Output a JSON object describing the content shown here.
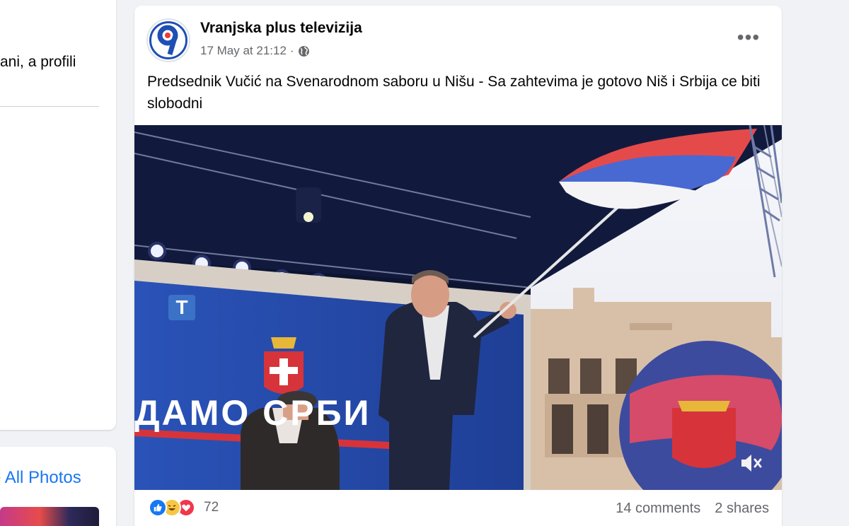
{
  "left_column": {
    "snippet_text": "ani, a profili",
    "see_all_photos": "e All Photos"
  },
  "post": {
    "page_name": "Vranjska plus televizija",
    "timestamp": "17 May at 21:12",
    "separator": "·",
    "audience_icon": "globe-icon",
    "text": "Predsednik Vučić na Svenarodnom saboru u Nišu - Sa zahtevima je gotovo Niš i Srbija ce biti slobodni",
    "avatar_icon": "nine-logo",
    "video": {
      "channel_logo": "T",
      "banner_text": "ДАМО СРБИ",
      "mute_icon": "speaker-muted-icon"
    },
    "footer": {
      "reaction_icons": [
        "like-icon",
        "haha-icon",
        "love-icon"
      ],
      "reaction_count": "72",
      "comments": "14 comments",
      "shares": "2 shares"
    }
  },
  "colors": {
    "facebook_blue": "#1877f2",
    "secondary_text": "#65676b",
    "background": "#f0f2f5"
  }
}
